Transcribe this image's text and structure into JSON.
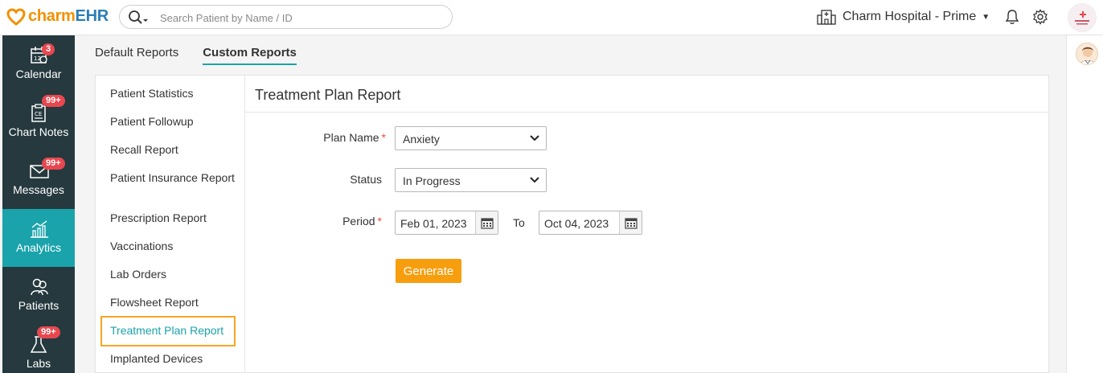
{
  "brand": {
    "charm": "charm",
    "ehr": "EHR"
  },
  "search": {
    "placeholder": "Search Patient by Name / ID"
  },
  "facility": {
    "name": "Charm Hospital - Prime"
  },
  "nav": {
    "calendar": {
      "label": "Calendar",
      "badge": "3"
    },
    "chart_notes": {
      "label": "Chart Notes",
      "badge": "99+"
    },
    "messages": {
      "label": "Messages",
      "badge": "99+"
    },
    "analytics": {
      "label": "Analytics"
    },
    "patients": {
      "label": "Patients"
    },
    "labs": {
      "label": "Labs",
      "badge": "99+"
    }
  },
  "tabs": {
    "default": "Default Reports",
    "custom": "Custom Reports"
  },
  "reports": [
    "Patient Statistics",
    "Patient Followup",
    "Recall Report",
    "Patient Insurance Report",
    "Prescription Report",
    "Vaccinations",
    "Lab Orders",
    "Flowsheet Report",
    "Treatment Plan Report",
    "Implanted Devices"
  ],
  "form": {
    "title": "Treatment Plan Report",
    "plan_label": "Plan Name",
    "plan_value": "Anxiety",
    "status_label": "Status",
    "status_value": "In Progress",
    "period_label": "Period",
    "from_date": "Feb 01, 2023",
    "to_label": "To",
    "to_date": "Oct 04, 2023",
    "required_mark": "*",
    "generate": "Generate"
  },
  "colors": {
    "accent": "#1aa3ab",
    "nav_bg": "#25393e",
    "brand_orange": "#f29100",
    "brand_blue": "#2a7fb8",
    "button": "#f79e0f",
    "badge": "#e8474f",
    "highlight": "#f5a524"
  }
}
